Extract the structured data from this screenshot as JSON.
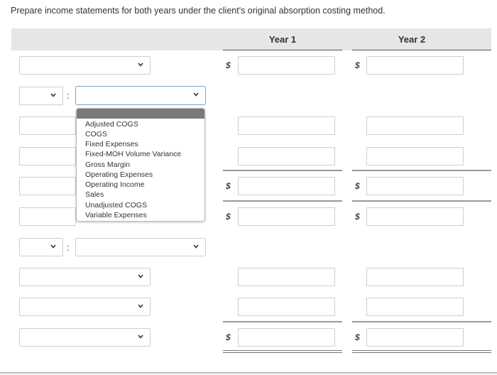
{
  "instruction": "Prepare income statements for both years under the client's original absorption costing method.",
  "columns": {
    "year1": "Year 1",
    "year2": "Year 2"
  },
  "currency_symbol": "$",
  "dropdown_options": [
    "Adjusted COGS",
    "COGS",
    "Fixed Expenses",
    "Fixed-MOH Volume Variance",
    "Gross Margin",
    "Operating Expenses",
    "Operating Income",
    "Sales",
    "Unadjusted COGS",
    "Variable Expenses"
  ],
  "rows": [
    {
      "label_value": "",
      "year1": "",
      "year2": ""
    },
    {
      "sign_value": "",
      "label_value": ""
    },
    {
      "label_value": "",
      "year1": "",
      "year2": ""
    },
    {
      "label_value": "",
      "year1": "",
      "year2": ""
    },
    {
      "label_value": "",
      "year1": "",
      "year2": ""
    },
    {
      "label_value": "",
      "year1": "",
      "year2": ""
    },
    {
      "sign_value": "",
      "label_value": ""
    },
    {
      "label_value": "",
      "year1": "",
      "year2": ""
    },
    {
      "label_value": "",
      "year1": "",
      "year2": ""
    },
    {
      "label_value": "",
      "year1": "",
      "year2": ""
    }
  ],
  "colors": {
    "header_bg": "#e6e6e6",
    "active_border": "#6ea0d8",
    "highlight": "#7a7a7a"
  }
}
